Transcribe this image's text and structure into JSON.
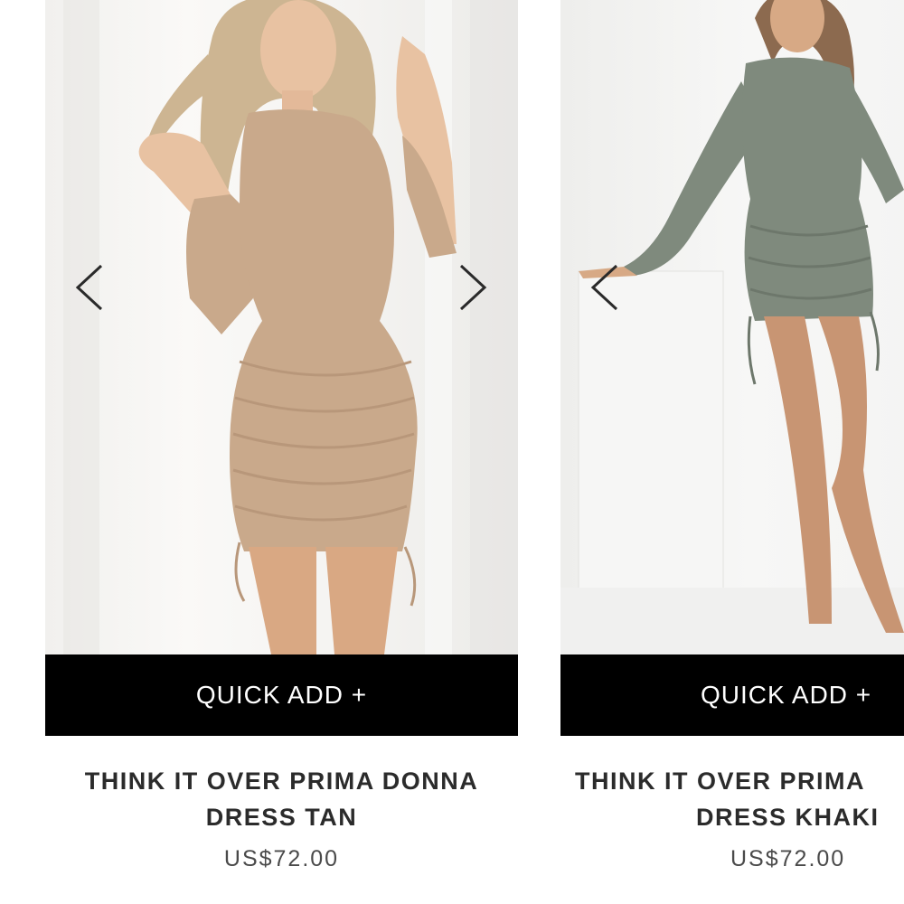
{
  "products": [
    {
      "image_alt": "Model in tan long sleeve ruched mini dress",
      "quick_add_label": "QUICK ADD +",
      "name_line1": "THINK IT OVER PRIMA DONNA",
      "name_line2": "DRESS TAN",
      "price": "US$72.00",
      "dress_color": "#c9a98b",
      "carousel_prev_icon": "chevron-left-icon",
      "carousel_next_icon": "chevron-right-icon"
    },
    {
      "image_alt": "Model in khaki long sleeve ruched mini dress",
      "quick_add_label": "QUICK ADD +",
      "name_line1": "THINK IT OVER PRIMA",
      "name_line2": "DRESS KHAKI",
      "price": "US$72.00",
      "dress_color": "#7f8a7d",
      "carousel_prev_icon": "chevron-left-icon"
    }
  ],
  "colors": {
    "button_bg": "#000000",
    "button_text": "#ffffff",
    "title_text": "#2b2b2b",
    "price_text": "#4a4a4a"
  }
}
